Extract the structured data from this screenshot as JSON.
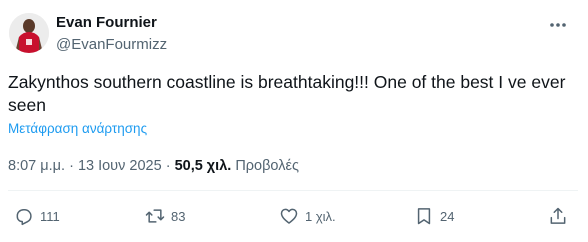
{
  "author": {
    "display_name": "Evan Fournier",
    "handle": "@EvanFourmizz"
  },
  "tweet": {
    "text": "Zakynthos southern coastline is breathtaking!!! One of the best I ve ever seen",
    "translate_label": "Μετάφραση ανάρτησης"
  },
  "meta": {
    "time": "8:07 μ.μ.",
    "separator": "·",
    "date": "13 Ιουν 2025",
    "views_count": "50,5 χιλ.",
    "views_label": "Προβολές"
  },
  "actions": {
    "replies": "111",
    "reposts": "83",
    "likes": "1 χιλ.",
    "bookmarks": "24"
  },
  "icons": {
    "avatar": "player-jersey-avatar",
    "more": "more-dots-icon",
    "reply": "reply-icon",
    "retweet": "retweet-icon",
    "like": "heart-icon",
    "bookmark": "bookmark-icon",
    "share": "share-icon"
  },
  "colors": {
    "text": "#0f1419",
    "secondary": "#536471",
    "link": "#1d9bf0",
    "jersey": "#c8102e"
  }
}
